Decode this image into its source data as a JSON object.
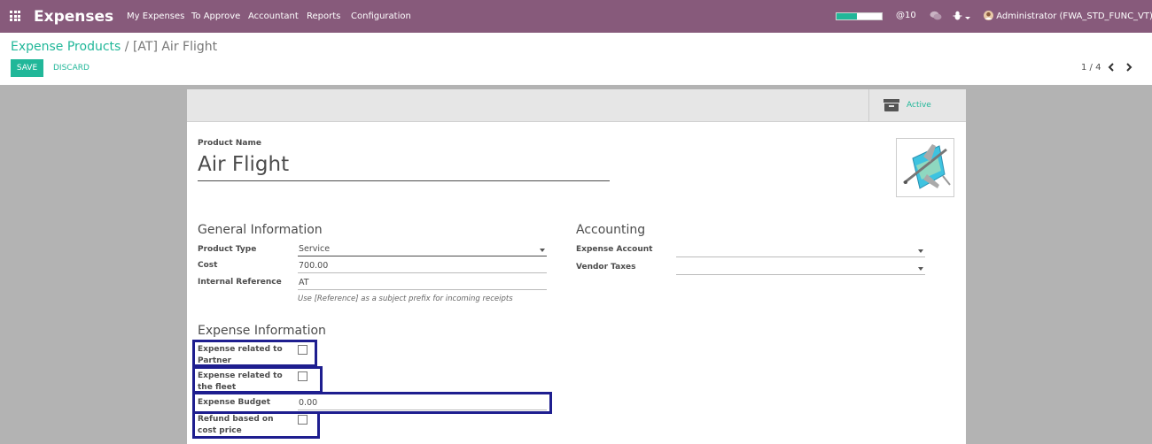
{
  "navbar": {
    "brand": "Expenses",
    "menu": [
      {
        "label": "My Expenses"
      },
      {
        "label": "To Approve"
      },
      {
        "label": "Accountant"
      },
      {
        "label": "Reports"
      },
      {
        "label": "Configuration"
      }
    ],
    "progress_fraction": 0.45,
    "mentions": "@10",
    "user": "Administrator (FWA_STD_FUNC_VT)"
  },
  "breadcrumb": {
    "parent": "Expense Products",
    "separator": "/",
    "current": "[AT] Air Flight"
  },
  "actions": {
    "save": "SAVE",
    "discard": "DISCARD"
  },
  "pager": {
    "value": "1 / 4",
    "prev": "‹",
    "next": "›"
  },
  "button_box": {
    "active_label": "Active",
    "icon": "archive-icon"
  },
  "form": {
    "product_name_label": "Product Name",
    "product_name": "Air Flight",
    "general": {
      "title": "General Information",
      "product_type_label": "Product Type",
      "product_type": "Service",
      "cost_label": "Cost",
      "cost": "700.00",
      "internal_ref_label": "Internal Reference",
      "internal_ref": "AT",
      "internal_ref_help": "Use [Reference] as a subject prefix for incoming receipts"
    },
    "accounting": {
      "title": "Accounting",
      "expense_account_label": "Expense Account",
      "expense_account": "",
      "vendor_taxes_label": "Vendor Taxes",
      "vendor_taxes": ""
    },
    "expense": {
      "title": "Expense Information",
      "partner_label": "Expense related to Partner",
      "partner_checked": false,
      "fleet_label": "Expense related to the fleet",
      "fleet_checked": false,
      "budget_label": "Expense Budget",
      "budget": "0.00",
      "refund_label": "Refund based on cost price",
      "refund_checked": false
    }
  },
  "colors": {
    "navbar": "#875a7b",
    "accent": "#21b799",
    "highlight": "#1e1e8f",
    "background": "#b3b3b3"
  }
}
